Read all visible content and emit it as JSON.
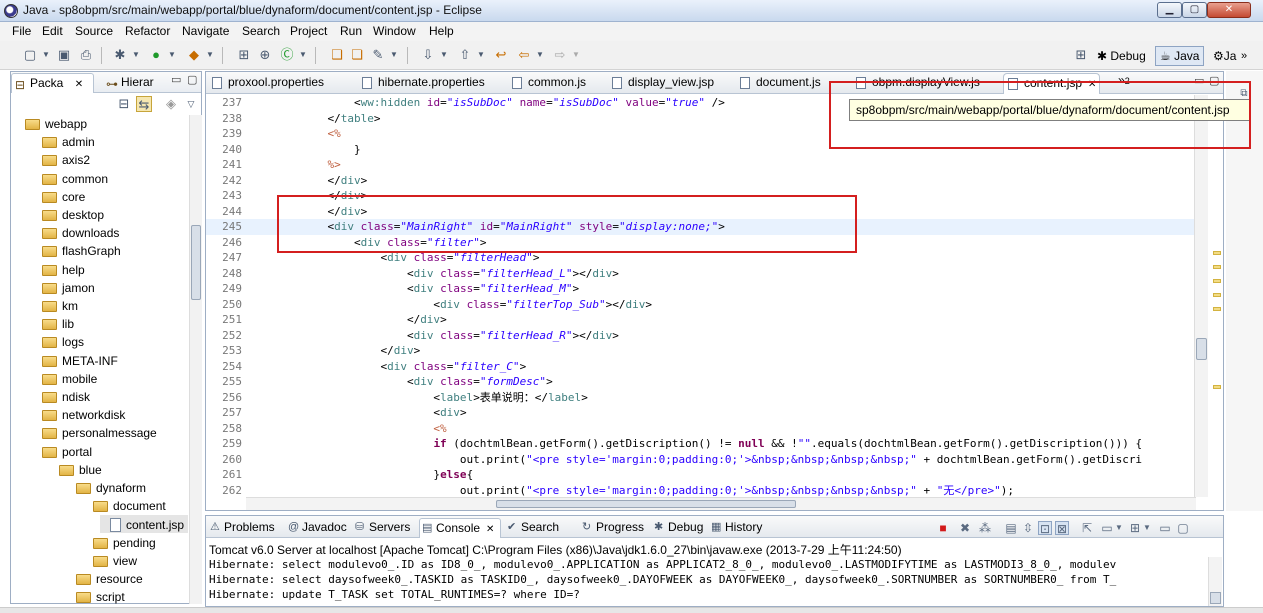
{
  "window": {
    "title": "Java - sp8obpm/src/main/webapp/portal/blue/dynaform/document/content.jsp - Eclipse",
    "minimize": "▁",
    "maximize": "▢",
    "close": "✕"
  },
  "menu": [
    "File",
    "Edit",
    "Source",
    "Refactor",
    "Navigate",
    "Search",
    "Project",
    "Run",
    "Window",
    "Help"
  ],
  "perspectives": {
    "debug": "Debug",
    "java": "Java",
    "more": "Ja",
    "overflow": "»"
  },
  "left_view": {
    "tabs": [
      {
        "label": "Packa",
        "close": "✕"
      },
      {
        "label": "Hierar"
      }
    ],
    "tree": [
      {
        "label": "webapp",
        "type": "folder",
        "depth": 0,
        "expanded": true
      },
      {
        "label": "admin",
        "type": "folder",
        "depth": 1
      },
      {
        "label": "axis2",
        "type": "folder",
        "depth": 1
      },
      {
        "label": "common",
        "type": "folder",
        "depth": 1
      },
      {
        "label": "core",
        "type": "folder",
        "depth": 1
      },
      {
        "label": "desktop",
        "type": "folder",
        "depth": 1
      },
      {
        "label": "downloads",
        "type": "folder",
        "depth": 1
      },
      {
        "label": "flashGraph",
        "type": "folder",
        "depth": 1
      },
      {
        "label": "help",
        "type": "folder",
        "depth": 1
      },
      {
        "label": "jamon",
        "type": "folder",
        "depth": 1
      },
      {
        "label": "km",
        "type": "folder",
        "depth": 1
      },
      {
        "label": "lib",
        "type": "folder",
        "depth": 1
      },
      {
        "label": "logs",
        "type": "folder",
        "depth": 1
      },
      {
        "label": "META-INF",
        "type": "folder",
        "depth": 1
      },
      {
        "label": "mobile",
        "type": "folder",
        "depth": 1
      },
      {
        "label": "ndisk",
        "type": "folder",
        "depth": 1
      },
      {
        "label": "networkdisk",
        "type": "folder",
        "depth": 1
      },
      {
        "label": "personalmessage",
        "type": "folder",
        "depth": 1
      },
      {
        "label": "portal",
        "type": "folder",
        "depth": 1,
        "expanded": true
      },
      {
        "label": "blue",
        "type": "folder",
        "depth": 2,
        "expanded": true
      },
      {
        "label": "dynaform",
        "type": "folder",
        "depth": 3,
        "expanded": true
      },
      {
        "label": "document",
        "type": "folder",
        "depth": 4,
        "expanded": true
      },
      {
        "label": "content.jsp",
        "type": "file",
        "depth": 5,
        "selected": true
      },
      {
        "label": "pending",
        "type": "folder",
        "depth": 4
      },
      {
        "label": "view",
        "type": "folder",
        "depth": 4
      },
      {
        "label": "resource",
        "type": "folder",
        "depth": 3
      },
      {
        "label": "script",
        "type": "folder",
        "depth": 3
      }
    ]
  },
  "editor": {
    "tabs": [
      {
        "label": "proxool.properties"
      },
      {
        "label": "hibernate.properties"
      },
      {
        "label": "common.js"
      },
      {
        "label": "display_view.jsp"
      },
      {
        "label": "document.js"
      },
      {
        "label": "obpm.displayView.js"
      },
      {
        "label": "content.jsp",
        "active": true,
        "close": "✕"
      }
    ],
    "overflow": "»",
    "overflow_count": "2",
    "lines": [
      {
        "n": "237",
        "segs": [
          [
            "ct",
            "                <"
          ],
          [
            "tag",
            "ww:hidden"
          ],
          [
            "ct",
            " "
          ],
          [
            "attr",
            "id"
          ],
          [
            "ct",
            "="
          ],
          [
            "val",
            "\"isSubDoc\""
          ],
          [
            "ct",
            " "
          ],
          [
            "attr",
            "name"
          ],
          [
            "ct",
            "="
          ],
          [
            "val",
            "\"isSubDoc\""
          ],
          [
            "ct",
            " "
          ],
          [
            "attr",
            "value"
          ],
          [
            "ct",
            "="
          ],
          [
            "val",
            "\"true\""
          ],
          [
            "ct",
            " />"
          ]
        ]
      },
      {
        "n": "238",
        "segs": [
          [
            "ct",
            "            </"
          ],
          [
            "tag",
            "table"
          ],
          [
            "ct",
            ">"
          ]
        ]
      },
      {
        "n": "239",
        "segs": [
          [
            "jsp",
            "            <%"
          ]
        ]
      },
      {
        "n": "240",
        "segs": [
          [
            "ct",
            "                }"
          ]
        ]
      },
      {
        "n": "241",
        "segs": [
          [
            "jsp",
            "            %>"
          ]
        ]
      },
      {
        "n": "242",
        "segs": [
          [
            "ct",
            "            </"
          ],
          [
            "tag",
            "div"
          ],
          [
            "ct",
            ">"
          ]
        ]
      },
      {
        "n": "243",
        "segs": [
          [
            "ct",
            "            </"
          ],
          [
            "tag",
            "div"
          ],
          [
            "ct",
            ">"
          ]
        ]
      },
      {
        "n": "244",
        "segs": [
          [
            "ct",
            "            </"
          ],
          [
            "tag",
            "div"
          ],
          [
            "ct",
            ">"
          ]
        ]
      },
      {
        "n": "245",
        "hl": true,
        "segs": [
          [
            "ct",
            "            <"
          ],
          [
            "tag",
            "div"
          ],
          [
            "ct",
            " "
          ],
          [
            "attr",
            "class"
          ],
          [
            "ct",
            "="
          ],
          [
            "val",
            "\"MainRight\""
          ],
          [
            "ct",
            " "
          ],
          [
            "attr",
            "id"
          ],
          [
            "ct",
            "="
          ],
          [
            "val",
            "\"MainRight\""
          ],
          [
            "ct",
            " "
          ],
          [
            "attr",
            "style"
          ],
          [
            "ct",
            "="
          ],
          [
            "val",
            "\"display:none;\""
          ],
          [
            "ct",
            ">"
          ]
        ]
      },
      {
        "n": "246",
        "segs": [
          [
            "ct",
            "                <"
          ],
          [
            "tag",
            "div"
          ],
          [
            "ct",
            " "
          ],
          [
            "attr",
            "class"
          ],
          [
            "ct",
            "="
          ],
          [
            "val",
            "\"filter\""
          ],
          [
            "ct",
            ">"
          ]
        ]
      },
      {
        "n": "247",
        "segs": [
          [
            "ct",
            "                    <"
          ],
          [
            "tag",
            "div"
          ],
          [
            "ct",
            " "
          ],
          [
            "attr",
            "class"
          ],
          [
            "ct",
            "="
          ],
          [
            "val",
            "\"filterHead\""
          ],
          [
            "ct",
            ">"
          ]
        ]
      },
      {
        "n": "248",
        "segs": [
          [
            "ct",
            "                        <"
          ],
          [
            "tag",
            "div"
          ],
          [
            "ct",
            " "
          ],
          [
            "attr",
            "class"
          ],
          [
            "ct",
            "="
          ],
          [
            "val",
            "\"filterHead_L\""
          ],
          [
            "ct",
            "></"
          ],
          [
            "tag",
            "div"
          ],
          [
            "ct",
            ">"
          ]
        ]
      },
      {
        "n": "249",
        "segs": [
          [
            "ct",
            "                        <"
          ],
          [
            "tag",
            "div"
          ],
          [
            "ct",
            " "
          ],
          [
            "attr",
            "class"
          ],
          [
            "ct",
            "="
          ],
          [
            "val",
            "\"filterHead_M\""
          ],
          [
            "ct",
            ">"
          ]
        ]
      },
      {
        "n": "250",
        "segs": [
          [
            "ct",
            "                            <"
          ],
          [
            "tag",
            "div"
          ],
          [
            "ct",
            " "
          ],
          [
            "attr",
            "class"
          ],
          [
            "ct",
            "="
          ],
          [
            "val",
            "\"filterTop_Sub\""
          ],
          [
            "ct",
            "></"
          ],
          [
            "tag",
            "div"
          ],
          [
            "ct",
            ">"
          ]
        ]
      },
      {
        "n": "251",
        "segs": [
          [
            "ct",
            "                        </"
          ],
          [
            "tag",
            "div"
          ],
          [
            "ct",
            ">"
          ]
        ]
      },
      {
        "n": "252",
        "segs": [
          [
            "ct",
            "                        <"
          ],
          [
            "tag",
            "div"
          ],
          [
            "ct",
            " "
          ],
          [
            "attr",
            "class"
          ],
          [
            "ct",
            "="
          ],
          [
            "val",
            "\"filterHead_R\""
          ],
          [
            "ct",
            "></"
          ],
          [
            "tag",
            "div"
          ],
          [
            "ct",
            ">"
          ]
        ]
      },
      {
        "n": "253",
        "segs": [
          [
            "ct",
            "                    </"
          ],
          [
            "tag",
            "div"
          ],
          [
            "ct",
            ">"
          ]
        ]
      },
      {
        "n": "254",
        "segs": [
          [
            "ct",
            "                    <"
          ],
          [
            "tag",
            "div"
          ],
          [
            "ct",
            " "
          ],
          [
            "attr",
            "class"
          ],
          [
            "ct",
            "="
          ],
          [
            "val",
            "\"filter_C\""
          ],
          [
            "ct",
            ">"
          ]
        ]
      },
      {
        "n": "255",
        "segs": [
          [
            "ct",
            "                        <"
          ],
          [
            "tag",
            "div"
          ],
          [
            "ct",
            " "
          ],
          [
            "attr",
            "class"
          ],
          [
            "ct",
            "="
          ],
          [
            "val",
            "\"formDesc\""
          ],
          [
            "ct",
            ">"
          ]
        ]
      },
      {
        "n": "256",
        "segs": [
          [
            "ct",
            "                            <"
          ],
          [
            "tag",
            "label"
          ],
          [
            "ct",
            ">表单说明：</"
          ],
          [
            "tag",
            "label"
          ],
          [
            "ct",
            ">"
          ]
        ]
      },
      {
        "n": "257",
        "segs": [
          [
            "ct",
            "                            <"
          ],
          [
            "tag",
            "div"
          ],
          [
            "ct",
            ">"
          ]
        ]
      },
      {
        "n": "258",
        "segs": [
          [
            "jsp",
            "                            <%"
          ]
        ]
      },
      {
        "n": "259",
        "segs": [
          [
            "ct",
            "                            "
          ],
          [
            "kw",
            "if"
          ],
          [
            "ct",
            " (dochtmlBean.getForm().getDiscription() != "
          ],
          [
            "kw",
            "null"
          ],
          [
            "ct",
            " && !"
          ],
          [
            "str",
            "\"\""
          ],
          [
            "ct",
            ".equals(dochtmlBean.getForm().getDiscription())) {"
          ]
        ]
      },
      {
        "n": "260",
        "segs": [
          [
            "ct",
            "                                out.print("
          ],
          [
            "str",
            "\"<pre style='margin:0;padding:0;'>&nbsp;&nbsp;&nbsp;&nbsp;\""
          ],
          [
            "ct",
            " + dochtmlBean.getForm().getDiscri"
          ]
        ]
      },
      {
        "n": "261",
        "segs": [
          [
            "ct",
            "                            }"
          ],
          [
            "kw",
            "else"
          ],
          [
            "ct",
            "{"
          ]
        ]
      },
      {
        "n": "262",
        "segs": [
          [
            "ct",
            "                                out.print("
          ],
          [
            "str",
            "\"<pre style='margin:0;padding:0;'>&nbsp;&nbsp;&nbsp;&nbsp;\""
          ],
          [
            "ct",
            " + "
          ],
          [
            "str",
            "\"无</pre>\""
          ],
          [
            "ct",
            ");"
          ]
        ]
      }
    ]
  },
  "tooltip": "sp8obpm/src/main/webapp/portal/blue/dynaform/document/content.jsp",
  "console": {
    "tabs": [
      {
        "label": "Problems",
        "icon": "⚠"
      },
      {
        "label": "Javadoc",
        "icon": "@"
      },
      {
        "label": "Servers",
        "icon": "⛁"
      },
      {
        "label": "Console",
        "icon": "▤",
        "active": true,
        "close": "✕"
      },
      {
        "label": "Search",
        "icon": "✔"
      },
      {
        "label": "Progress",
        "icon": "↻"
      },
      {
        "label": "Debug",
        "icon": "✱"
      },
      {
        "label": "History",
        "icon": "▦"
      }
    ],
    "title": "Tomcat v6.0 Server at localhost [Apache Tomcat] C:\\Program Files (x86)\\Java\\jdk1.6.0_27\\bin\\javaw.exe (2013-7-29 上午11:24:50)",
    "lines": [
      "Hibernate: select modulevo0_.ID as ID8_0_, modulevo0_.APPLICATION as APPLICAT2_8_0_, modulevo0_.LASTMODIFYTIME as LASTMODI3_8_0_, modulev",
      "Hibernate: select daysofweek0_.TASKID as TASKID0_, daysofweek0_.DAYOFWEEK as DAYOFWEEK0_, daysofweek0_.SORTNUMBER as SORTNUMBER0_ from T_",
      "Hibernate: update T_TASK set TOTAL_RUNTIMES=? where ID=?"
    ]
  },
  "colors": {
    "annotation": "#d41f1f",
    "current_line": "#e8f2fe",
    "tooltip_bg": "#ffffe1"
  }
}
